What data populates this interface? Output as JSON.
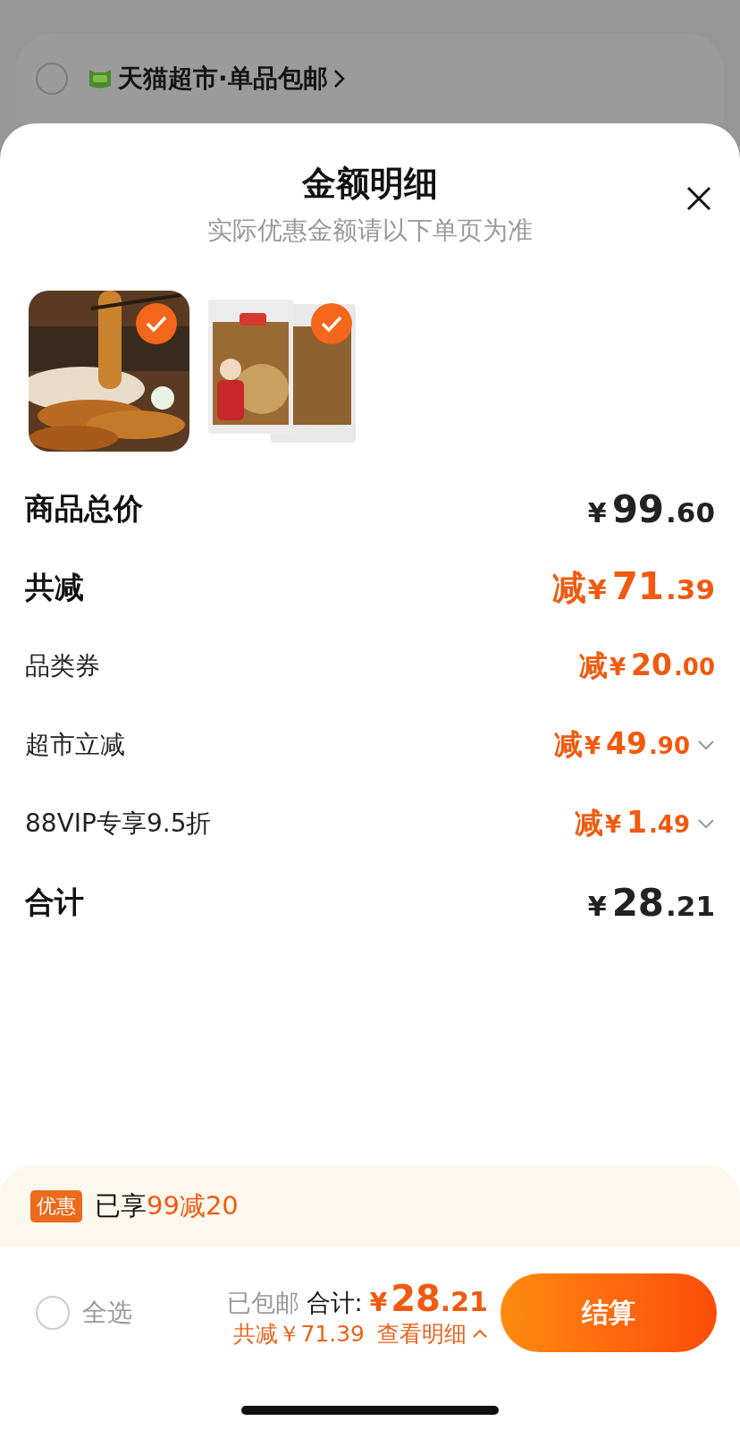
{
  "background_store": {
    "name": "天猫超市·单品包邮",
    "checked": false
  },
  "sheet": {
    "title": "金额明细",
    "subtitle": "实际优惠金额请以下单页为准"
  },
  "products": [
    {
      "kind": "picture",
      "selected": true
    },
    {
      "kind": "picture",
      "selected": true
    }
  ],
  "rows": [
    {
      "kind": "total",
      "label": "商品总价",
      "prefix": "",
      "currency": "¥",
      "int": "99",
      "dec": ".60",
      "expandable": false
    },
    {
      "kind": "discount_total",
      "label": "共减",
      "prefix": "减",
      "currency": "¥",
      "int": "71",
      "dec": ".39",
      "expandable": false
    },
    {
      "kind": "discount",
      "label": "品类券",
      "prefix": "减",
      "currency": "¥",
      "int": "20",
      "dec": ".00",
      "expandable": false
    },
    {
      "kind": "discount",
      "label": "超市立减",
      "prefix": "减",
      "currency": "¥",
      "int": "49",
      "dec": ".90",
      "expandable": true
    },
    {
      "kind": "discount",
      "label": "88VIP专享9.5折",
      "prefix": "减",
      "currency": "¥",
      "int": "1",
      "dec": ".49",
      "expandable": true
    },
    {
      "kind": "total",
      "label": "合计",
      "prefix": "",
      "currency": "¥",
      "int": "28",
      "dec": ".21",
      "expandable": false
    }
  ],
  "promo": {
    "badge": "优惠",
    "text": "已享",
    "highlight": "99减20"
  },
  "footer": {
    "select_all": {
      "label": "全选",
      "checked": false
    },
    "shipping": "已包邮",
    "total_label": "合计:",
    "total_currency": "¥",
    "total_int": "28",
    "total_dec": ".21",
    "discount": "共减￥71.39",
    "details_link": "查看明细",
    "checkout": "结算"
  }
}
